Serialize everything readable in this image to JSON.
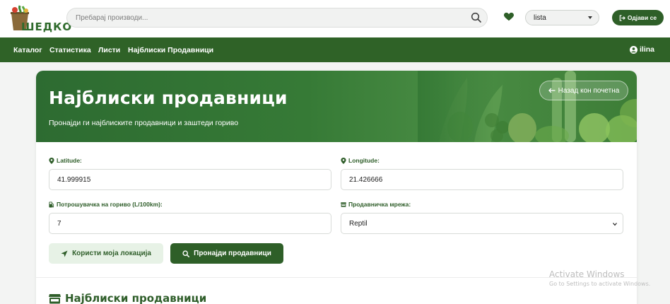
{
  "header": {
    "logo_text": "ШЕДКО",
    "search_placeholder": "Пребарај производи...",
    "list_selected": "lista",
    "logout_label": "Одјави се"
  },
  "nav": {
    "items": [
      {
        "label": "Каталог"
      },
      {
        "label": "Статистика"
      },
      {
        "label": "Листи"
      },
      {
        "label": "Најблиски Продавници"
      }
    ],
    "user": "ilina"
  },
  "hero": {
    "title": "Најблиски продавници",
    "subtitle": "Пронајди ги најблиските продавници и заштеди гориво",
    "back_label": "Назад кон почетна"
  },
  "form": {
    "latitude_label": "Latitude:",
    "latitude_value": "41.999915",
    "longitude_label": "Longitude:",
    "longitude_value": "21.426666",
    "fuel_label": "Потрошувачка на гориво (L/100km):",
    "fuel_value": "7",
    "network_label": "Продавничка мрежа:",
    "network_value": "Reptil",
    "use_location_label": "Користи моја локација",
    "find_label": "Пронајди продавници"
  },
  "results": {
    "title": "Најблиски продавници"
  },
  "watermark": {
    "title": "Activate Windows",
    "subtitle": "Go to Settings to activate Windows."
  },
  "colors": {
    "brand_green": "#2f6227",
    "accent_green": "#2e5f28",
    "light_green": "#e7f2e6"
  },
  "icons": [
    "search-icon",
    "heart-icon",
    "logout-icon",
    "user-icon",
    "arrow-left-icon",
    "map-marker-icon",
    "gas-pump-icon",
    "store-icon",
    "location-arrow-icon"
  ]
}
